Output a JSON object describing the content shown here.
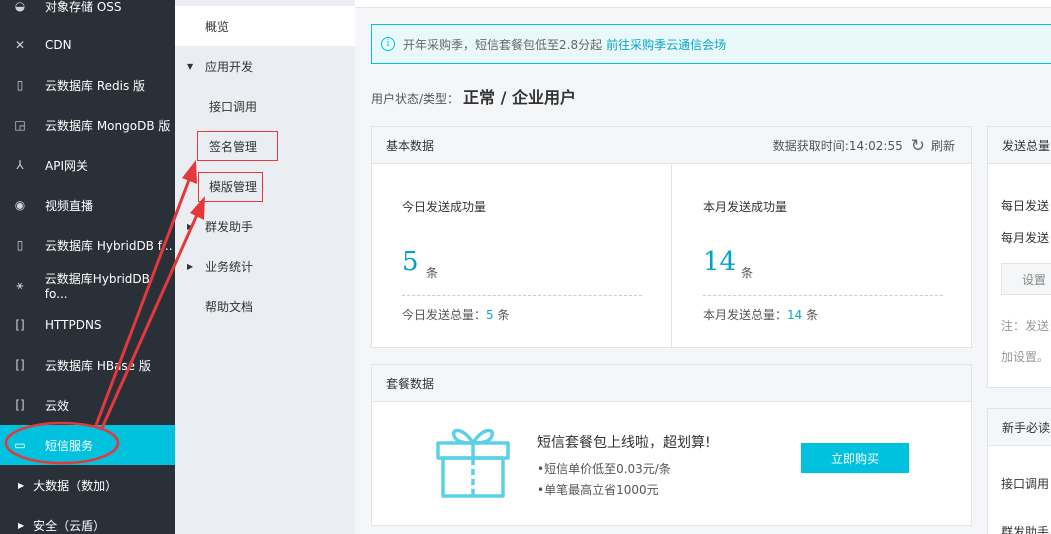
{
  "sidebar": {
    "items": [
      {
        "icon": "object-storage-icon",
        "label": "对象存储 OSS"
      },
      {
        "icon": "cdn-icon",
        "label": "CDN"
      },
      {
        "icon": "redis-icon",
        "label": "云数据库 Redis 版"
      },
      {
        "icon": "mongodb-icon",
        "label": "云数据库 MongoDB 版"
      },
      {
        "icon": "api-gateway-icon",
        "label": "API网关"
      },
      {
        "icon": "live-video-icon",
        "label": "视频直播"
      },
      {
        "icon": "hybriddb-icon",
        "label": "云数据库 HybridDB f..."
      },
      {
        "icon": "hybriddb-network-icon",
        "label": "云数据库HybridDB fo..."
      },
      {
        "icon": "httpdns-icon",
        "label": "HTTPDNS"
      },
      {
        "icon": "hbase-icon",
        "label": "云数据库 HBase 版"
      },
      {
        "icon": "yunxiao-icon",
        "label": "云效"
      },
      {
        "icon": "sms-icon",
        "label": "短信服务"
      }
    ],
    "groups": [
      {
        "label": "大数据（数加）"
      },
      {
        "label": "安全（云盾）"
      }
    ]
  },
  "subnav": {
    "overview": "概览",
    "app_dev": "应用开发",
    "api_call": "接口调用",
    "signature": "签名管理",
    "template": "模版管理",
    "bulk_send": "群发助手",
    "business_stats": "业务统计",
    "help_docs": "帮助文档"
  },
  "notice": {
    "text": "开年采购季，短信套餐包低至2.8分起",
    "link": "前往采购季云通信会场"
  },
  "status": {
    "label": "用户状态/类型：",
    "value": "正常 / 企业用户"
  },
  "basic": {
    "title": "基本数据",
    "time_label": "数据获取时间:14:02:55",
    "refresh": "刷新",
    "today": {
      "title": "今日发送成功量",
      "value": "5",
      "unit": "条",
      "total_label": "今日发送总量：",
      "total_value": "5",
      "total_unit": " 条"
    },
    "month": {
      "title": "本月发送成功量",
      "value": "14",
      "unit": "条",
      "total_label": "本月发送总量：",
      "total_value": "14",
      "total_unit": " 条"
    }
  },
  "package": {
    "title": "套餐数据",
    "promo_title": "短信套餐包上线啦，超划算!",
    "bullet1": "•短信单价低至0.03元/条",
    "bullet2": "•单笔最高立省1000元",
    "buy_button": "立即购买"
  },
  "right_panel1": {
    "title": "发送总量",
    "line1": "每日发送",
    "line2": "每月发送",
    "set_button": "设置",
    "note1": "注：发送",
    "note2": "加设置。"
  },
  "right_panel2": {
    "title": "新手必读",
    "line1": "接口调用",
    "line2": "群发助手"
  },
  "colors": {
    "accent": "#00c1de",
    "sidebar_bg": "#293038",
    "annotation_red": "#e4393c"
  }
}
